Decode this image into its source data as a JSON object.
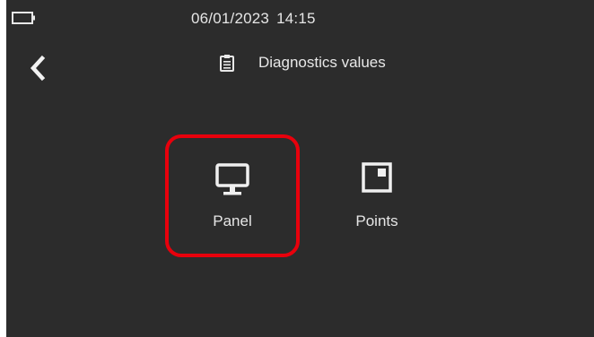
{
  "status_bar": {
    "date": "06/01/2023",
    "time": "14:15",
    "battery_icon": "battery-empty-icon"
  },
  "header": {
    "back_icon": "chevron-left-icon",
    "title_icon": "clipboard-icon",
    "title": "Diagnostics values"
  },
  "menu": {
    "items": [
      {
        "label": "Panel",
        "icon": "monitor-icon",
        "selected": true
      },
      {
        "label": "Points",
        "icon": "square-dot-icon",
        "selected": false
      }
    ]
  },
  "colors": {
    "background": "#2c2c2c",
    "text": "#e6e6e6",
    "selection_border": "#e8000c"
  }
}
